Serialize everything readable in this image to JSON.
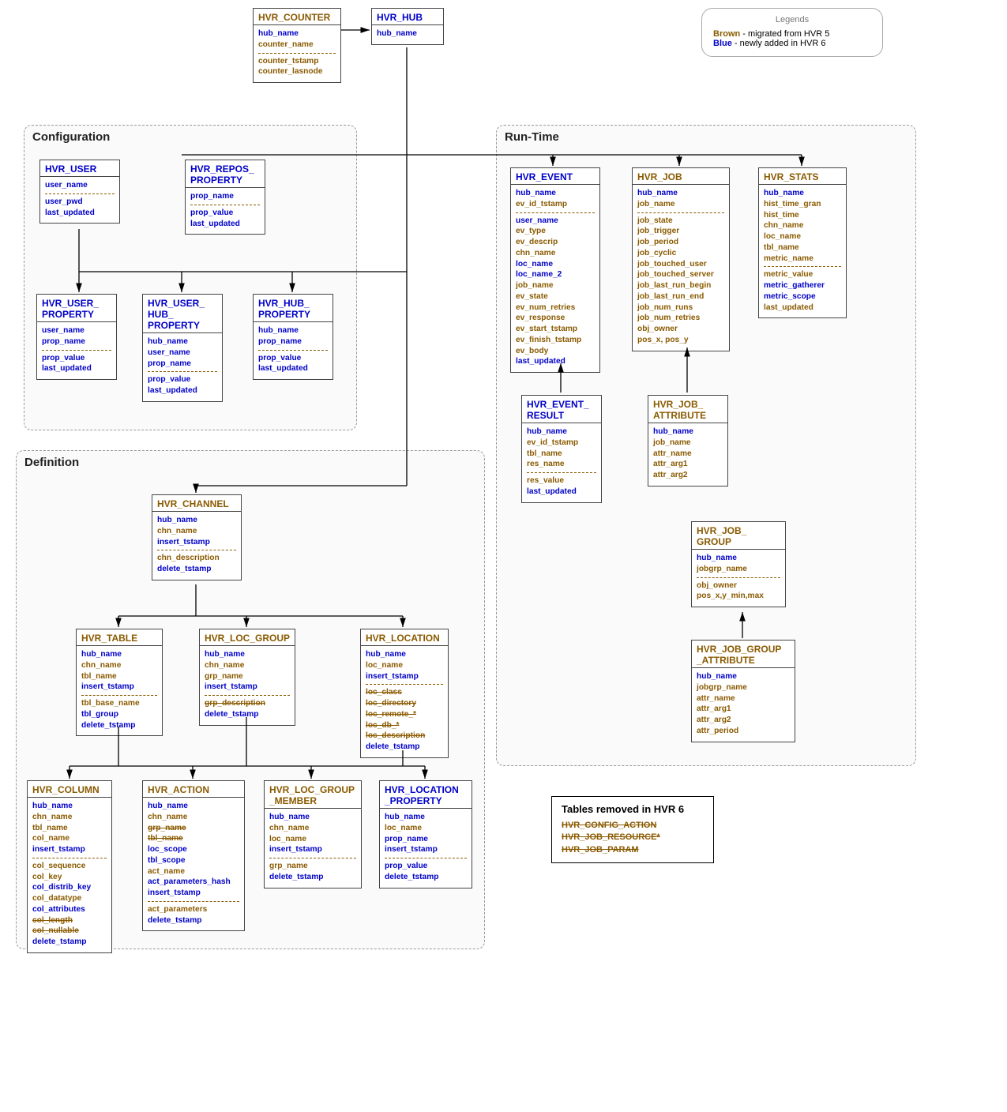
{
  "legends": {
    "title": "Legends",
    "brown_label": "Brown",
    "brown_text": " - migrated from HVR 5",
    "blue_label": "Blue",
    "blue_text": "   - newly added in HVR 6"
  },
  "groups": {
    "configuration": "Configuration",
    "definition": "Definition",
    "runtime": "Run-Time"
  },
  "removed": {
    "title": "Tables removed in HVR 6",
    "items": [
      "HVR_CONFIG_ACTION",
      "HVR_JOB_RESOURCE*",
      "HVR_JOB_PARAM"
    ]
  },
  "tables": {
    "hvr_counter": {
      "title": "HVR_COUNTER",
      "title_color": "brown",
      "pk": [
        [
          "hub_name",
          "blue"
        ],
        [
          "counter_name",
          "brown"
        ]
      ],
      "attrs": [
        [
          "counter_tstamp",
          "brown"
        ],
        [
          "counter_lasnode",
          "brown"
        ]
      ]
    },
    "hvr_hub": {
      "title": "HVR_HUB",
      "title_color": "blue",
      "pk": [
        [
          "hub_name",
          "blue"
        ]
      ],
      "attrs": []
    },
    "hvr_user": {
      "title": "HVR_USER",
      "title_color": "blue",
      "pk": [
        [
          "user_name",
          "blue"
        ]
      ],
      "attrs": [
        [
          "user_pwd",
          "blue"
        ],
        [
          "last_updated",
          "blue"
        ]
      ]
    },
    "hvr_repos_property": {
      "title": "HVR_REPOS_\nPROPERTY",
      "title_color": "blue",
      "pk": [
        [
          "prop_name",
          "blue"
        ]
      ],
      "attrs": [
        [
          "prop_value",
          "blue"
        ],
        [
          "last_updated",
          "blue"
        ]
      ]
    },
    "hvr_user_property": {
      "title": "HVR_USER_\nPROPERTY",
      "title_color": "blue",
      "pk": [
        [
          "user_name",
          "blue"
        ],
        [
          "prop_name",
          "blue"
        ]
      ],
      "attrs": [
        [
          "prop_value",
          "blue"
        ],
        [
          "last_updated",
          "blue"
        ]
      ]
    },
    "hvr_user_hub_property": {
      "title": "HVR_USER_\nHUB_\nPROPERTY",
      "title_color": "blue",
      "pk": [
        [
          "hub_name",
          "blue"
        ],
        [
          "user_name",
          "blue"
        ],
        [
          "prop_name",
          "blue"
        ]
      ],
      "attrs": [
        [
          "prop_value",
          "blue"
        ],
        [
          "last_updated",
          "blue"
        ]
      ]
    },
    "hvr_hub_property": {
      "title": "HVR_HUB_\nPROPERTY",
      "title_color": "blue",
      "pk": [
        [
          "hub_name",
          "blue"
        ],
        [
          "prop_name",
          "blue"
        ]
      ],
      "attrs": [
        [
          "prop_value",
          "blue"
        ],
        [
          "last_updated",
          "blue"
        ]
      ]
    },
    "hvr_event": {
      "title": "HVR_EVENT",
      "title_color": "blue",
      "pk": [
        [
          "hub_name",
          "blue"
        ],
        [
          "ev_id_tstamp",
          "brown"
        ]
      ],
      "attrs": [
        [
          "user_name",
          "blue"
        ],
        [
          "ev_type",
          "brown"
        ],
        [
          "ev_descrip",
          "brown"
        ],
        [
          "chn_name",
          "brown"
        ],
        [
          "loc_name",
          "blue"
        ],
        [
          "loc_name_2",
          "blue"
        ],
        [
          "job_name",
          "brown"
        ],
        [
          "ev_state",
          "brown"
        ],
        [
          "ev_num_retries",
          "brown"
        ],
        [
          "ev_response",
          "brown"
        ],
        [
          "ev_start_tstamp",
          "brown"
        ],
        [
          "ev_finish_tstamp",
          "brown"
        ],
        [
          "ev_body",
          "brown"
        ],
        [
          "last_updated",
          "blue"
        ]
      ]
    },
    "hvr_job": {
      "title": "HVR_JOB",
      "title_color": "brown",
      "pk": [
        [
          "hub_name",
          "blue"
        ],
        [
          "job_name",
          "brown"
        ]
      ],
      "attrs": [
        [
          "job_state",
          "brown"
        ],
        [
          "job_trigger",
          "brown"
        ],
        [
          "job_period",
          "brown"
        ],
        [
          "job_cyclic",
          "brown"
        ],
        [
          "job_touched_user",
          "brown"
        ],
        [
          "job_touched_server",
          "brown"
        ],
        [
          "job_last_run_begin",
          "brown"
        ],
        [
          "job_last_run_end",
          "brown"
        ],
        [
          "job_num_runs",
          "brown"
        ],
        [
          "job_num_retries",
          "brown"
        ],
        [
          "obj_owner",
          "brown"
        ],
        [
          "pos_x, pos_y",
          "brown"
        ]
      ]
    },
    "hvr_stats": {
      "title": "HVR_STATS",
      "title_color": "brown",
      "pk": [
        [
          "hub_name",
          "blue"
        ],
        [
          "hist_time_gran",
          "brown"
        ],
        [
          "hist_time",
          "brown"
        ],
        [
          "chn_name",
          "brown"
        ],
        [
          "loc_name",
          "brown"
        ],
        [
          "tbl_name",
          "brown"
        ],
        [
          "metric_name",
          "brown"
        ]
      ],
      "attrs": [
        [
          "metric_value",
          "brown"
        ],
        [
          "metric_gatherer",
          "blue"
        ],
        [
          "metric_scope",
          "blue"
        ],
        [
          "last_updated",
          "brown"
        ]
      ]
    },
    "hvr_event_result": {
      "title": "HVR_EVENT_\nRESULT",
      "title_color": "blue",
      "pk": [
        [
          "hub_name",
          "blue"
        ],
        [
          "ev_id_tstamp",
          "brown"
        ],
        [
          "tbl_name",
          "brown"
        ],
        [
          "res_name",
          "brown"
        ]
      ],
      "attrs": [
        [
          "res_value",
          "brown"
        ],
        [
          "last_updated",
          "blue"
        ]
      ]
    },
    "hvr_job_attribute": {
      "title": "HVR_JOB_\nATTRIBUTE",
      "title_color": "brown",
      "pk": [
        [
          "hub_name",
          "blue"
        ],
        [
          "job_name",
          "brown"
        ],
        [
          "attr_name",
          "brown"
        ],
        [
          "attr_arg1",
          "brown"
        ],
        [
          "attr_arg2",
          "brown"
        ]
      ],
      "attrs": []
    },
    "hvr_job_group": {
      "title": "HVR_JOB_\nGROUP",
      "title_color": "brown",
      "pk": [
        [
          "hub_name",
          "blue"
        ],
        [
          "jobgrp_name",
          "brown"
        ]
      ],
      "attrs": [
        [
          "obj_owner",
          "brown"
        ],
        [
          "pos_x,y_min,max",
          "brown"
        ]
      ]
    },
    "hvr_job_group_attribute": {
      "title": "HVR_JOB_GROUP\n_ATTRIBUTE",
      "title_color": "brown",
      "pk": [
        [
          "hub_name",
          "blue"
        ],
        [
          "jobgrp_name",
          "brown"
        ],
        [
          "attr_name",
          "brown"
        ],
        [
          "attr_arg1",
          "brown"
        ],
        [
          "attr_arg2",
          "brown"
        ],
        [
          "attr_period",
          "brown"
        ]
      ],
      "attrs": []
    },
    "hvr_channel": {
      "title": "HVR_CHANNEL",
      "title_color": "brown",
      "pk": [
        [
          "hub_name",
          "blue"
        ],
        [
          "chn_name",
          "brown"
        ],
        [
          "insert_tstamp",
          "blue"
        ]
      ],
      "attrs": [
        [
          "chn_description",
          "brown"
        ],
        [
          "delete_tstamp",
          "blue"
        ]
      ]
    },
    "hvr_table": {
      "title": "HVR_TABLE",
      "title_color": "brown",
      "pk": [
        [
          "hub_name",
          "blue"
        ],
        [
          "chn_name",
          "brown"
        ],
        [
          "tbl_name",
          "brown"
        ],
        [
          "insert_tstamp",
          "blue"
        ]
      ],
      "attrs": [
        [
          "tbl_base_name",
          "brown"
        ],
        [
          "tbl_group",
          "blue"
        ],
        [
          "delete_tstamp",
          "blue"
        ]
      ]
    },
    "hvr_loc_group": {
      "title": "HVR_LOC_GROUP",
      "title_color": "brown",
      "pk": [
        [
          "hub_name",
          "blue"
        ],
        [
          "chn_name",
          "brown"
        ],
        [
          "grp_name",
          "brown"
        ],
        [
          "insert_tstamp",
          "blue"
        ]
      ],
      "attrs": [
        [
          "grp_description",
          "brown",
          "strike"
        ],
        [
          "delete_tstamp",
          "blue"
        ]
      ]
    },
    "hvr_location": {
      "title": "HVR_LOCATION",
      "title_color": "brown",
      "pk": [
        [
          "hub_name",
          "blue"
        ],
        [
          "loc_name",
          "brown"
        ],
        [
          "insert_tstamp",
          "blue"
        ]
      ],
      "attrs": [
        [
          "loc_class",
          "brown",
          "strike"
        ],
        [
          "loc_directory",
          "brown",
          "strike"
        ],
        [
          "loc_remote_*",
          "brown",
          "strike"
        ],
        [
          "loc_db_*",
          "brown",
          "strike"
        ],
        [
          "loc_description",
          "brown",
          "strike"
        ],
        [
          "delete_tstamp",
          "blue"
        ]
      ]
    },
    "hvr_column": {
      "title": "HVR_COLUMN",
      "title_color": "brown",
      "pk": [
        [
          "hub_name",
          "blue"
        ],
        [
          "chn_name",
          "brown"
        ],
        [
          "tbl_name",
          "brown"
        ],
        [
          "col_name",
          "brown"
        ],
        [
          "insert_tstamp",
          "blue"
        ]
      ],
      "attrs": [
        [
          "col_sequence",
          "brown"
        ],
        [
          "col_key",
          "brown"
        ],
        [
          "col_distrib_key",
          "blue"
        ],
        [
          "col_datatype",
          "brown"
        ],
        [
          "col_attributes",
          "blue"
        ],
        [
          "col_length",
          "brown",
          "strike"
        ],
        [
          "col_nullable",
          "brown",
          "strike"
        ],
        [
          "delete_tstamp",
          "blue"
        ]
      ]
    },
    "hvr_action": {
      "title": "HVR_ACTION",
      "title_color": "brown",
      "pk": [
        [
          "hub_name",
          "blue"
        ],
        [
          "chn_name",
          "brown"
        ],
        [
          "grp_name",
          "brown",
          "strike"
        ],
        [
          "tbl_name",
          "brown",
          "strike"
        ],
        [
          "loc_scope",
          "blue"
        ],
        [
          "tbl_scope",
          "blue"
        ],
        [
          "act_name",
          "brown"
        ],
        [
          "act_parameters_hash",
          "blue"
        ],
        [
          "insert_tstamp",
          "blue"
        ]
      ],
      "attrs": [
        [
          "act_parameters",
          "brown"
        ],
        [
          "delete_tstamp",
          "blue"
        ]
      ]
    },
    "hvr_loc_group_member": {
      "title": "HVR_LOC_GROUP\n_MEMBER",
      "title_color": "brown",
      "pk": [
        [
          "hub_name",
          "blue"
        ],
        [
          "chn_name",
          "brown"
        ],
        [
          "loc_name",
          "brown"
        ],
        [
          "insert_tstamp",
          "blue"
        ]
      ],
      "attrs": [
        [
          "grp_name",
          "brown"
        ],
        [
          "delete_tstamp",
          "blue"
        ]
      ]
    },
    "hvr_location_property": {
      "title": "HVR_LOCATION\n_PROPERTY",
      "title_color": "blue",
      "pk": [
        [
          "hub_name",
          "blue"
        ],
        [
          "loc_name",
          "brown"
        ],
        [
          "prop_name",
          "blue"
        ],
        [
          "insert_tstamp",
          "blue"
        ]
      ],
      "attrs": [
        [
          "prop_value",
          "blue"
        ],
        [
          "delete_tstamp",
          "blue"
        ]
      ]
    }
  }
}
